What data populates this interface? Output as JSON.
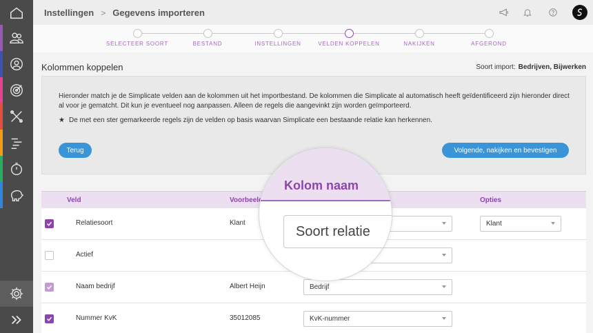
{
  "header": {
    "breadcrumb": [
      "Instellingen",
      "Gegevens importeren"
    ],
    "separator": ">"
  },
  "sidebar": {
    "items": [
      {
        "icon": "home-icon",
        "color": "#4a4a4a"
      },
      {
        "icon": "users-icon",
        "color": "#9b59b6"
      },
      {
        "icon": "contact-icon",
        "color": "#3f51b5"
      },
      {
        "icon": "target-icon",
        "color": "#e84393"
      },
      {
        "icon": "tools-icon",
        "color": "#e74c3c"
      },
      {
        "icon": "planning-icon",
        "color": "#f39c12"
      },
      {
        "icon": "timer-icon",
        "color": "#27ae60"
      },
      {
        "icon": "piggybank-icon",
        "color": "#2e86de"
      },
      {
        "icon": "gear-icon",
        "color": "#5d5d5d"
      },
      {
        "icon": "expand-icon",
        "color": "#4a4a4a"
      }
    ]
  },
  "stepper": {
    "steps": [
      "SELECTEER SOORT",
      "BESTAND",
      "INSTELLINGEN",
      "VELDEN KOPPELEN",
      "NAKIJKEN",
      "AFGEROND"
    ],
    "active_index": 3
  },
  "page": {
    "title": "Kolommen koppelen",
    "import_type_label": "Soort import:",
    "import_type_value": "Bedrijven, Bijwerken"
  },
  "info": {
    "text": "Hieronder match je de Simplicate velden aan de kolommen uit het importbestand. De kolommen die Simplicate al automatisch heeft geïdentificeerd zijn hieronder direct al voor je gematcht. Dit kun je eventueel nog aanpassen. Alleen de regels die aangevinkt zijn worden geïmporteerd.",
    "star_note": "De met een ster gemarkeerde regels zijn de velden op basis waarvan Simplicate een bestaande relatie kan herkennen.",
    "back_button": "Terug",
    "next_button": "Volgende, nakijken en bevestigen"
  },
  "table": {
    "headers": {
      "field": "Veld",
      "example": "Voorbeeld",
      "options": "Opties"
    },
    "rows": [
      {
        "checked": true,
        "light": false,
        "field": "Relatiesoort",
        "example": "Klant",
        "column": "",
        "option": "Klant"
      },
      {
        "checked": false,
        "light": false,
        "field": "Actief",
        "example": "",
        "column": "",
        "option": ""
      },
      {
        "checked": true,
        "light": true,
        "field": "Naam bedrijf",
        "example": "Albert Heijn",
        "column": "Bedrijf",
        "option": ""
      },
      {
        "checked": true,
        "light": false,
        "field": "Nummer KvK",
        "example": "35012085",
        "column": "KvK-nummer",
        "option": ""
      }
    ]
  },
  "magnifier": {
    "title": "Kolom naam",
    "select_value": "Soort relatie"
  },
  "colors": {
    "accent": "#8e44ad",
    "button": "#3a94d8",
    "sidebar": "#4a4a4a"
  }
}
